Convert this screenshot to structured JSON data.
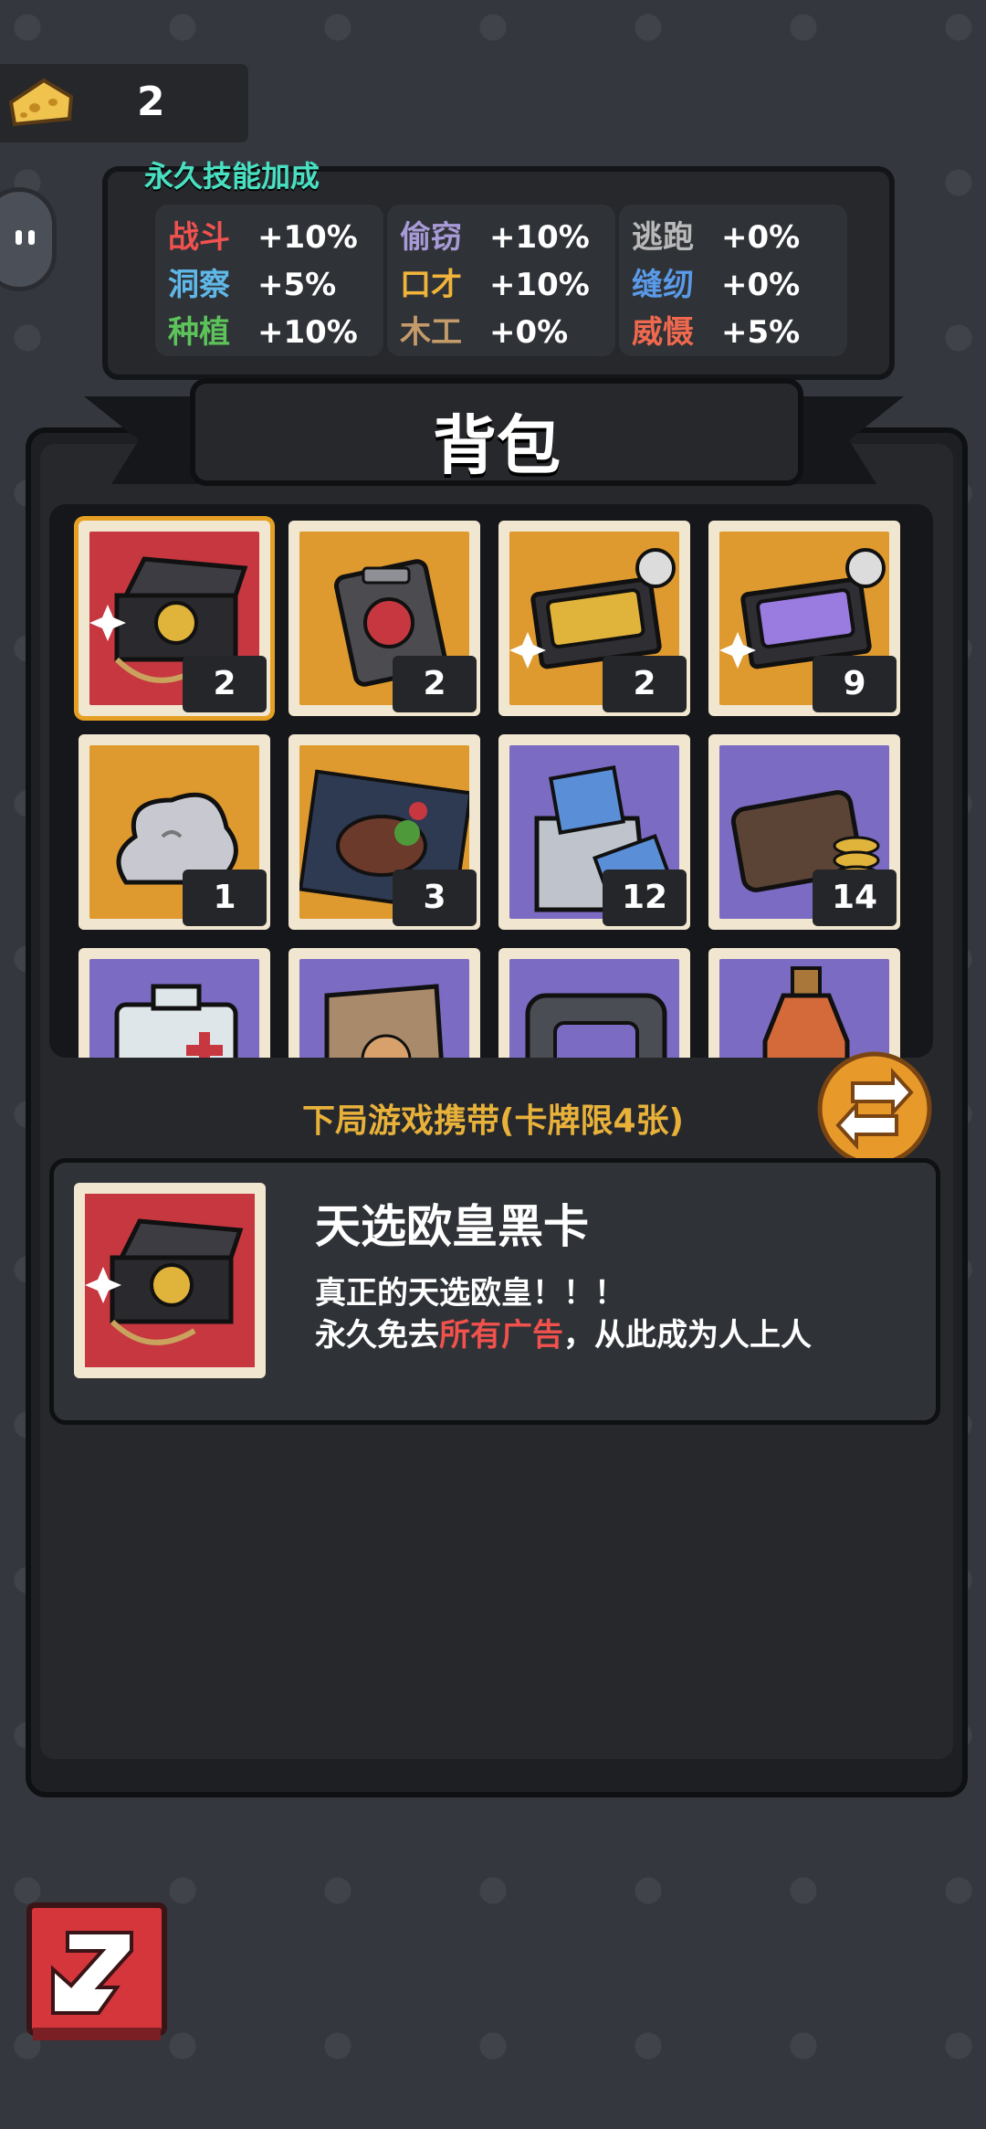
{
  "cheese": {
    "count": "2",
    "icon": "cheese-icon"
  },
  "skills": {
    "title": "永久技能加成",
    "columns": [
      [
        {
          "name": "战斗",
          "value": "+10%",
          "color": "#f0524f"
        },
        {
          "name": "洞察",
          "value": "+5%",
          "color": "#5fb8e8"
        },
        {
          "name": "种植",
          "value": "+10%",
          "color": "#5cc35a"
        }
      ],
      [
        {
          "name": "偷窃",
          "value": "+10%",
          "color": "#a89ad6"
        },
        {
          "name": "口才",
          "value": "+10%",
          "color": "#f0b43a"
        },
        {
          "name": "木工",
          "value": "+0%",
          "color": "#c39b6a"
        }
      ],
      [
        {
          "name": "逃跑",
          "value": "+0%",
          "color": "#b9b9b9"
        },
        {
          "name": "缝纫",
          "value": "+0%",
          "color": "#5a9ae8"
        },
        {
          "name": "威慑",
          "value": "+5%",
          "color": "#f0694f"
        }
      ]
    ]
  },
  "bag": {
    "title": "背包",
    "items": [
      {
        "count": "2",
        "bg": "#c7373f",
        "icon": "black-card-box-icon",
        "selected": true
      },
      {
        "count": "2",
        "bg": "#df9a2f",
        "icon": "card-pack-icon"
      },
      {
        "count": "2",
        "bg": "#df9a2f",
        "icon": "gold-card-box-icon"
      },
      {
        "count": "9",
        "bg": "#df9a2f",
        "icon": "purple-card-box-icon"
      },
      {
        "count": "1",
        "bg": "#df9a2f",
        "icon": "cloud-pillow-icon"
      },
      {
        "count": "3",
        "bg": "#df9a2f",
        "icon": "steak-icon"
      },
      {
        "count": "12",
        "bg": "#7b6bc2",
        "icon": "cash-bag-icon"
      },
      {
        "count": "14",
        "bg": "#7b6bc2",
        "icon": "wallet-icon"
      },
      {
        "count": "",
        "bg": "#7b6bc2",
        "icon": "medkit-icon"
      },
      {
        "count": "",
        "bg": "#7b6bc2",
        "icon": "paper-bag-icon"
      },
      {
        "count": "",
        "bg": "#7b6bc2",
        "icon": "case-icon"
      },
      {
        "count": "",
        "bg": "#7b6bc2",
        "icon": "bottle-icon"
      }
    ],
    "carry_label": "下局游戏携带(卡牌限4张)"
  },
  "detail": {
    "name": "天选欧皇黑卡",
    "line1": "真正的天选欧皇！！！",
    "line2_pre": "永久免去",
    "line2_hl": "所有广告",
    "line2_post": "，从此成为人上人"
  }
}
